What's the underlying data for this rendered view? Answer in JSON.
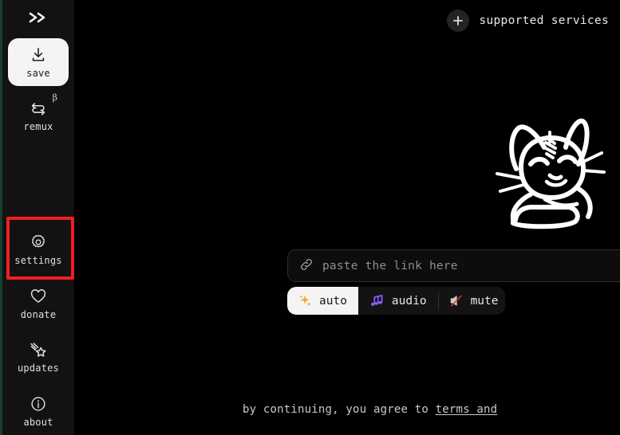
{
  "theme": {
    "background": "#000000",
    "sidebar_bg": "#121212",
    "edge_strip": "#17402b",
    "accent_light": "#f4f4f4",
    "selection_ring": "#ee1f25",
    "text": "#e3e3e3",
    "muted_text": "#8e8e8e",
    "audio_icon": "#8b5cf6",
    "auto_icon": "#f5a623"
  },
  "sidebar": {
    "collapse": {
      "name": "collapse-toggle",
      "icon": "chevrons-right-icon"
    },
    "items": [
      {
        "label": "save",
        "icon": "download-icon",
        "primary": true,
        "badge": ""
      },
      {
        "label": "remux",
        "icon": "loop-arrows-icon",
        "primary": false,
        "badge": "β"
      },
      {
        "label": "settings",
        "icon": "gear-icon",
        "primary": false,
        "badge": "",
        "selected": true
      },
      {
        "label": "donate",
        "icon": "heart-icon",
        "primary": false,
        "badge": ""
      },
      {
        "label": "updates",
        "icon": "shooting-star-icon",
        "primary": false,
        "badge": ""
      },
      {
        "label": "about",
        "icon": "info-circle-icon",
        "primary": false,
        "badge": ""
      }
    ]
  },
  "header": {
    "supported_services_label": "supported services",
    "supported_services_icon": "plus-circle-icon"
  },
  "main": {
    "mascot_alt": "cobalt cat mascot",
    "url_input": {
      "placeholder": "paste the link here",
      "value": "",
      "icon": "link-icon"
    },
    "modes": [
      {
        "label": "auto",
        "icon": "✨",
        "icon_name": "sparkles-icon",
        "active": true
      },
      {
        "label": "audio",
        "icon": "🎶",
        "icon_name": "music-notes-icon",
        "active": false
      },
      {
        "label": "mute",
        "icon": "🔇",
        "icon_name": "muted-speaker-icon",
        "active": false
      }
    ]
  },
  "footer": {
    "terms_prefix": "by continuing, you agree to ",
    "terms_link": "terms and"
  }
}
